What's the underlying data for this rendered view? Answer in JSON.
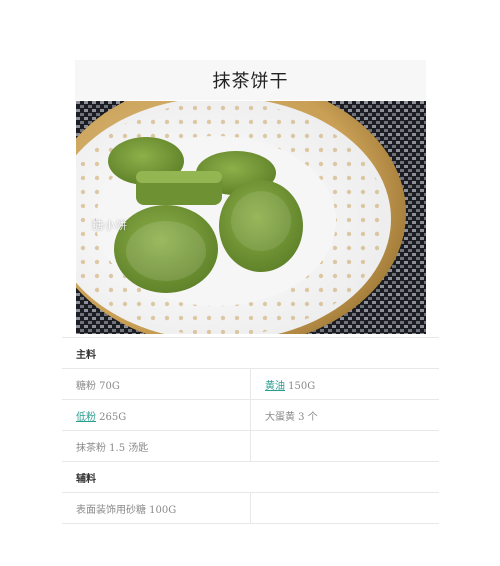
{
  "page": {
    "title": "抹茶饼干"
  },
  "photo": {
    "watermark": "糖小饼"
  },
  "ingredients": {
    "main_heading": "主料",
    "main_rows": [
      [
        {
          "name": "糖粉",
          "amount": " 70G",
          "link": false
        },
        {
          "name": "黄油",
          "amount": " 150G",
          "link": true
        }
      ],
      [
        {
          "name": "低粉",
          "amount": " 265G",
          "link": true
        },
        {
          "name": "大蛋黄",
          "amount": " 3 个",
          "link": false
        }
      ],
      [
        {
          "name": "抹茶粉",
          "amount": " 1.5 汤匙",
          "link": false
        },
        {
          "name": "",
          "amount": "",
          "link": false
        }
      ]
    ],
    "aux_heading": "辅料",
    "aux_rows": [
      [
        {
          "name": "表面装饰用砂糖",
          "amount": " 100G",
          "link": false
        },
        {
          "name": "",
          "amount": "",
          "link": false
        }
      ]
    ]
  },
  "colors": {
    "link": "#2a9d8f",
    "title_bar": "#f7f7f7",
    "muted_text": "#8a8a8a"
  }
}
